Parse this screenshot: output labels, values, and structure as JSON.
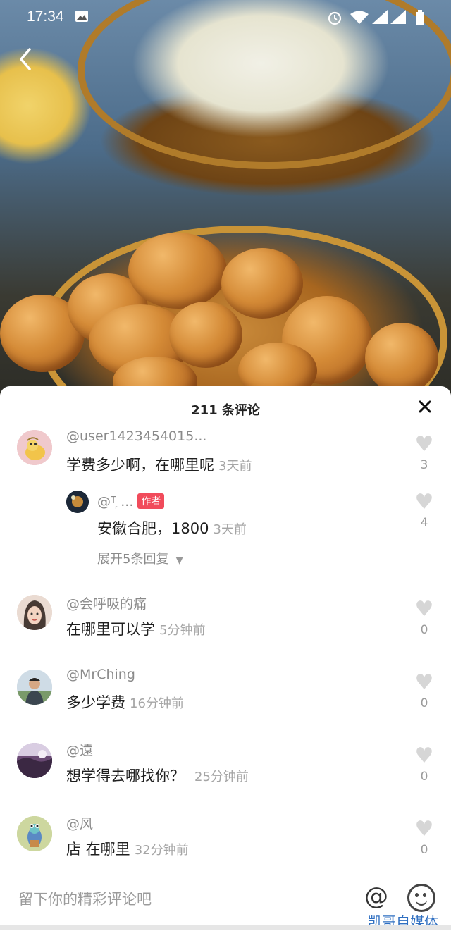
{
  "status_bar": {
    "time": "17:34",
    "icons": [
      "image-icon",
      "alarm-icon",
      "wifi-icon",
      "signal-icon",
      "battery-icon"
    ]
  },
  "nav": {
    "back_icon": "chevron-left-icon"
  },
  "comments_panel": {
    "title": "211 条评论",
    "close_icon": "close-icon",
    "comments": [
      {
        "username": "@user1423454015...",
        "text": "学费多少啊，在哪里呢",
        "time": "3天前",
        "likes": "3"
      },
      {
        "username": "@ᵀ᷊ ...",
        "author_tag": "作者",
        "text": "安徽合肥，1800",
        "time": "3天前",
        "likes": "4",
        "is_reply": true
      },
      {
        "username": "@会呼吸的痛",
        "text": "在哪里可以学",
        "time": "5分钟前",
        "likes": "0"
      },
      {
        "username": "@MrChing",
        "text": "多少学费",
        "time": "16分钟前",
        "likes": "0"
      },
      {
        "username": "@遠",
        "text": "想学得去哪找你？",
        "time": "25分钟前",
        "likes": "0"
      },
      {
        "username": "@风",
        "text": "店 在哪里",
        "time": "32分钟前",
        "likes": "0"
      }
    ],
    "expand_replies": "展开5条回复"
  },
  "input_bar": {
    "placeholder": "留下你的精彩评论吧",
    "at_label": "@"
  },
  "watermark": "凯哥自媒体",
  "colors": {
    "author_tag": "#f14b5b",
    "watermark": "#2f6fc1",
    "heart": "#d6d6d6"
  }
}
